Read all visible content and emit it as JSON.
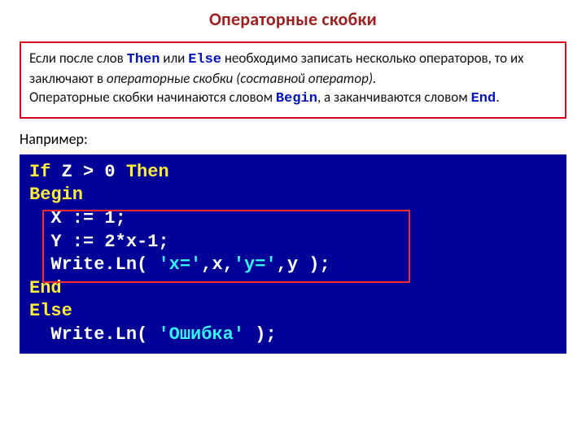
{
  "title": "Операторные скобки",
  "info": {
    "p1a": "Если после слов ",
    "kw_then": "Then",
    "p1b": "  или ",
    "kw_else": "Else",
    "p1c": " необходимо записать  несколько операторов, то их заключают в ",
    "ital": "операторные скобки (составной оператор).",
    "p2a": "Операторные скобки начинаются словом ",
    "kw_begin": "Begin",
    "p2b": ", а заканчиваются словом ",
    "kw_end": "End",
    "p2c": "."
  },
  "example_label": "Например:",
  "code": {
    "l1_a": "If",
    "l1_b": " Z > 0 ",
    "l1_c": "Then",
    "l2": "Begin",
    "l3": "  X := 1;",
    "l4": "  Y := 2*x-1;",
    "l5_a": "  Write.Ln( ",
    "l5_b": "'x='",
    "l5_c": ",x,",
    "l5_d": "'y='",
    "l5_e": ",y );",
    "l6": "End",
    "l7": "Else",
    "l8_a": "  Write.Ln( ",
    "l8_b": "'Ошибка'",
    "l8_c": " );"
  }
}
